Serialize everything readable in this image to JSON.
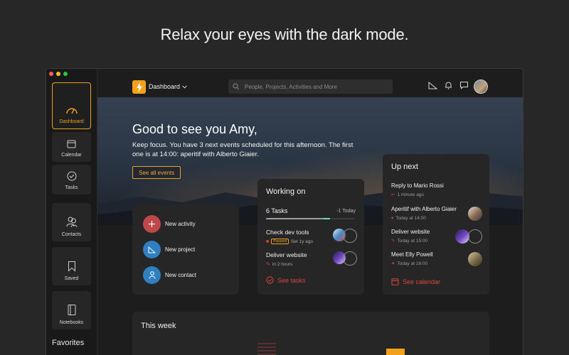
{
  "headline": "Relax your eyes with the dark mode.",
  "sidebar": {
    "items": [
      {
        "label": "Dashboard",
        "icon": "gauge-icon",
        "active": true
      },
      {
        "label": "Calendar",
        "icon": "calendar-icon"
      },
      {
        "label": "Tasks",
        "icon": "check-circle-icon"
      },
      {
        "label": "Contacts",
        "icon": "contacts-icon"
      },
      {
        "label": "Saved",
        "icon": "bookmark-icon"
      },
      {
        "label": "Notebooks",
        "icon": "notebook-icon"
      }
    ],
    "favorites_label": "Favorites"
  },
  "topbar": {
    "title": "Dashboard",
    "search_placeholder": "People, Projects, Activities and More"
  },
  "hero": {
    "greeting": "Good to see you Amy,",
    "subtitle": "Keep focus. You have 3 next events scheduled for this afternoon. The first one is at 14:00: aperitif with Alberto Giaier.",
    "see_all": "See all events"
  },
  "quick_actions": [
    {
      "label": "New activity",
      "color": "#c0474a"
    },
    {
      "label": "New project",
      "color": "#2f7fc1"
    },
    {
      "label": "New contact",
      "color": "#2f7fc1"
    }
  ],
  "working_on": {
    "title": "Working on",
    "count": "6 Tasks",
    "delta": "-1 Today",
    "progress": 0.64,
    "tasks": [
      {
        "name": "Check dev tools",
        "badge": "Paused",
        "meta": "Set 1y ago"
      },
      {
        "name": "Deliver website",
        "meta": "in 2 hours"
      }
    ],
    "link": "See tasks"
  },
  "up_next": {
    "title": "Up next",
    "items": [
      {
        "title": "Reply to Mario Rossi",
        "meta": "1 minute ago"
      },
      {
        "title": "Aperitif with Alberto Giaier",
        "meta": "Today at 14:00"
      },
      {
        "title": "Deliver website",
        "meta": "Today at 15:00"
      },
      {
        "title": "Meet Elly Powell",
        "meta": "Today at 16:00"
      }
    ],
    "link": "See calendar"
  },
  "this_week": {
    "title": "This week"
  },
  "colors": {
    "accent": "#f3a11b",
    "danger": "#d9463e",
    "blue": "#2f7fc1"
  }
}
